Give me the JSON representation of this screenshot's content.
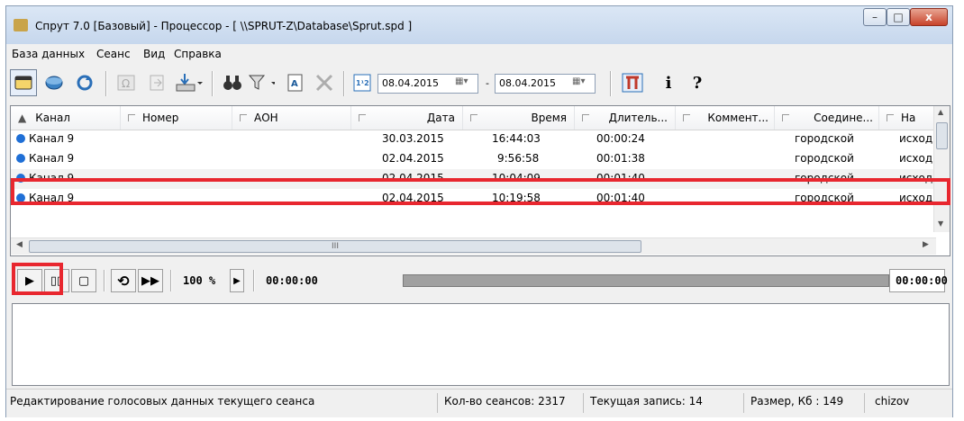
{
  "window": {
    "title": "Спрут 7.0 [Базовый] - Процессор - [ \\\\SPRUT-Z\\Database\\Sprut.spd ]",
    "minimize": "–",
    "maximize": "□",
    "close": "x"
  },
  "menu": [
    "База данных",
    "Сеанс",
    "Вид",
    "Справка"
  ],
  "toolbar": {
    "date_from": "08.04.2015",
    "date_separator": "-",
    "date_to": "08.04.2015",
    "icons": [
      "database-icon",
      "sessions-icon",
      "refresh-icon",
      "play-sound-icon",
      "export-icon",
      "download-icon",
      "binoculars-icon",
      "filter-icon",
      "report-icon",
      "delete-icon",
      "calendar-icon",
      "tools-icon",
      "info-icon",
      "help-icon"
    ]
  },
  "grid": {
    "columns": [
      "Канал",
      "Номер",
      "АОН",
      "Дата",
      "Время",
      "Длитель...",
      "Коммент...",
      "Соедине...",
      "На"
    ],
    "rows": [
      {
        "channel": "Канал 9",
        "number": "",
        "aon": "",
        "date": "30.03.2015",
        "time": "16:44:03",
        "duration": "00:00:24",
        "comment": "",
        "connection": "городской",
        "direction": "исходящ"
      },
      {
        "channel": "Канал 9",
        "number": "",
        "aon": "",
        "date": "02.04.2015",
        "time": "9:56:58",
        "duration": "00:01:38",
        "comment": "",
        "connection": "городской",
        "direction": "исходящ"
      },
      {
        "channel": "Канал 9",
        "number": "",
        "aon": "",
        "date": "02.04.2015",
        "time": "10:04:09",
        "duration": "00:01:40",
        "comment": "",
        "connection": "городской",
        "direction": "исходящ"
      },
      {
        "channel": "Канал 9",
        "number": "",
        "aon": "",
        "date": "02.04.2015",
        "time": "10:19:58",
        "duration": "00:01:40",
        "comment": "",
        "connection": "городской",
        "direction": "исходящ"
      }
    ],
    "hscroll_mark": "III"
  },
  "player": {
    "speed": "100 %",
    "position": "00:00:00",
    "total": "00:00:00"
  },
  "status": {
    "message": "Редактирование голосовых данных текущего сеанса",
    "sessions": "Кол-во сеансов: 2317",
    "current": "Текущая запись: 14",
    "size": "Размер, Кб : 149",
    "user": "chizov"
  },
  "colors": {
    "highlight": "#e8272f",
    "dot": "#1f6fd6"
  }
}
